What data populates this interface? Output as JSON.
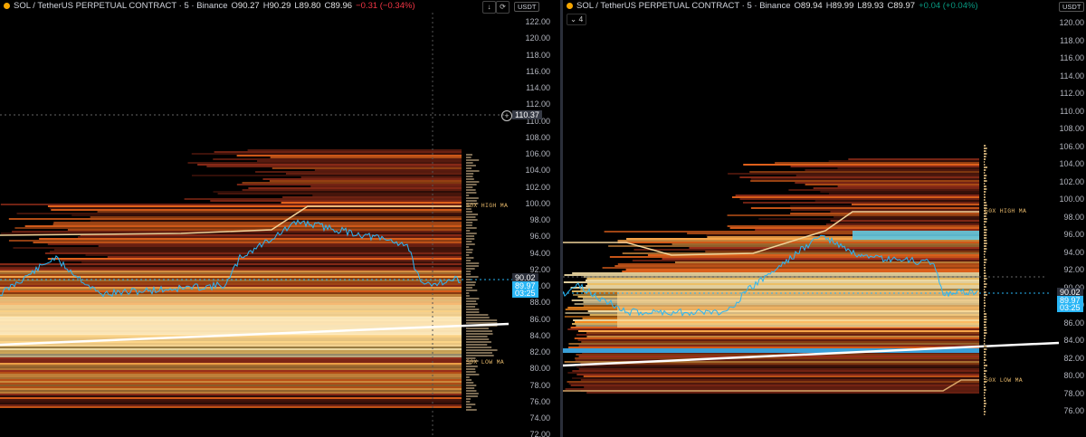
{
  "left": {
    "legend": {
      "symbol": "SOL / TetherUS PERPETUAL CONTRACT · 5 · Binance",
      "o_k": "O",
      "o": "90.27",
      "h_k": "H",
      "h": "90.29",
      "l_k": "L",
      "l": "89.80",
      "c_k": "C",
      "c": "89.96",
      "chg": "−0.31 (−0.34%)"
    },
    "axis_ticks": [
      "122.00",
      "120.00",
      "118.00",
      "116.00",
      "114.00",
      "112.00",
      "110.00",
      "108.00",
      "106.00",
      "104.00",
      "102.00",
      "100.00",
      "98.00",
      "96.00",
      "94.00",
      "92.00",
      "90.00",
      "88.00",
      "86.00",
      "84.00",
      "82.00",
      "80.00",
      "78.00",
      "76.00",
      "74.00",
      "72.00"
    ],
    "unit": "USDT",
    "crosshair_price": "110.37",
    "price_tag": "90.02",
    "last_price": "89.97",
    "countdown": "03:25",
    "ma_high_label": "50X HIGH MA",
    "ma_low_label": "50X LOW MA"
  },
  "right": {
    "legend": {
      "symbol": "SOL / TetherUS PERPETUAL CONTRACT · 5 · Binance",
      "o_k": "O",
      "o": "89.94",
      "h_k": "H",
      "h": "89.99",
      "l_k": "L",
      "l": "89.93",
      "c_k": "C",
      "c": "89.97",
      "chg": "+0.04 (+0.04%)"
    },
    "indicator_count": "4",
    "axis_ticks": [
      "120.00",
      "118.00",
      "116.00",
      "114.00",
      "112.00",
      "110.00",
      "108.00",
      "106.00",
      "104.00",
      "102.00",
      "100.00",
      "98.00",
      "96.00",
      "94.00",
      "92.00",
      "90.00",
      "88.00",
      "86.00",
      "84.00",
      "82.00",
      "80.00",
      "78.00",
      "76.00"
    ],
    "unit": "USDT",
    "price_tag": "90.02",
    "last_price": "89.97",
    "countdown": "03:25",
    "ma_high_label": "50X HIGH MA",
    "ma_low_label": "50X LOW MA"
  },
  "colors": {
    "bg": "#000000",
    "price_line": "#29b6f6",
    "heat_hot": "#ffe9b0",
    "heat_mid": "#f58a1f",
    "heat_low": "#a5321c",
    "down": "#f23645",
    "up": "#089981"
  }
}
